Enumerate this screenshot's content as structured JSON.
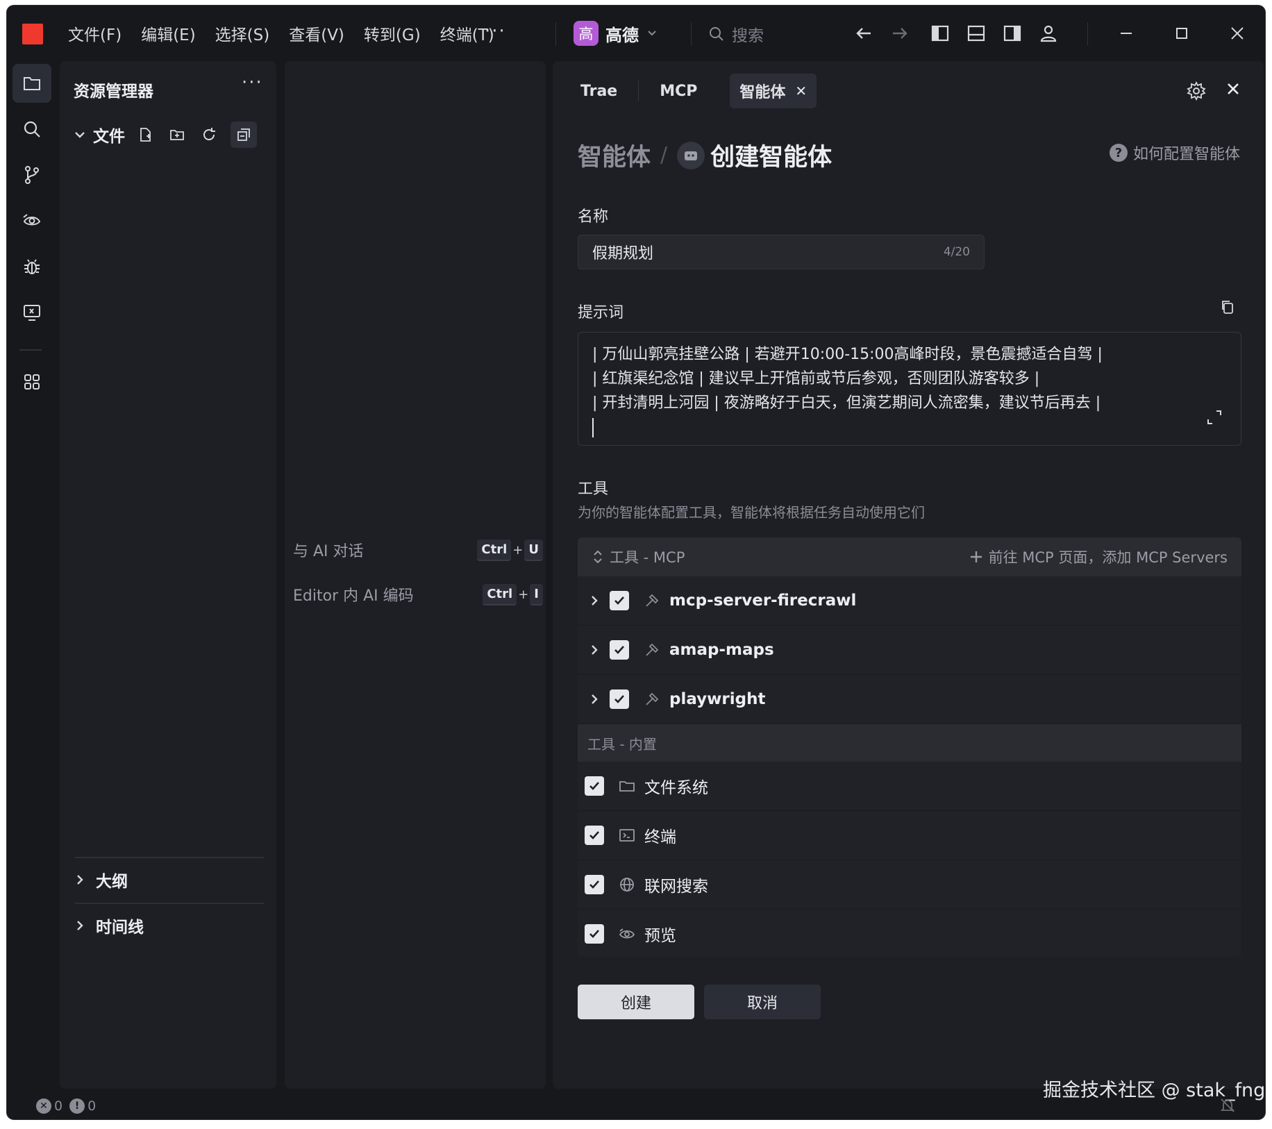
{
  "menu": [
    "文件(F)",
    "编辑(E)",
    "选择(S)",
    "查看(V)",
    "转到(G)",
    "终端(T)"
  ],
  "menu_more": "···",
  "project": {
    "avatar": "高",
    "name": "高德"
  },
  "search": {
    "placeholder": "搜索"
  },
  "explorer": {
    "title": "资源管理器",
    "more": "···",
    "folder": "文件",
    "outline": "大纲",
    "timeline": "时间线"
  },
  "middle": {
    "shortcuts": [
      {
        "label": "与 AI 对话",
        "keys": [
          "Ctrl",
          "U"
        ]
      },
      {
        "label": "Editor 内 AI 编码",
        "keys": [
          "Ctrl",
          "I"
        ]
      }
    ],
    "plus": "+"
  },
  "agent": {
    "tabs": {
      "trae": "Trae",
      "mcp": "MCP",
      "agent": "智能体"
    },
    "tab_close": "✕",
    "breadcrumb": {
      "parent": "智能体",
      "slash": "/",
      "current": "创建智能体"
    },
    "help": {
      "icon": "?",
      "text": "如何配置智能体"
    },
    "name": {
      "label": "名称",
      "value": "假期规划",
      "count": "4/20"
    },
    "prompt": {
      "label": "提示词",
      "lines": [
        "| 万仙山郭亮挂壁公路 | 若避开10:00-15:00高峰时段，景色震撼适合自驾 |",
        "| 红旗渠纪念馆 | 建议早上开馆前或节后参观，否则团队游客较多 |",
        "| 开封清明上河园 | 夜游略好于白天，但演艺期间人流密集，建议节后再去 |"
      ]
    },
    "tools": {
      "label": "工具",
      "desc": "为你的智能体配置工具，智能体将根据任务自动使用它们",
      "mcp_header": "工具 - MCP",
      "mcp_add": "前往 MCP 页面，添加 MCP Servers",
      "mcp_items": [
        "mcp-server-firecrawl",
        "amap-maps",
        "playwright"
      ],
      "builtin_header": "工具 - 内置",
      "builtin_items": [
        "文件系统",
        "终端",
        "联网搜索",
        "预览"
      ]
    },
    "buttons": {
      "create": "创建",
      "cancel": "取消"
    }
  },
  "status": {
    "errors": "0",
    "warnings": "0",
    "error_icon": "✕",
    "warning_icon": "!"
  },
  "watermark": "掘金技术社区 @ stak_fng",
  "colors": {
    "logo": "#f0392e",
    "avatar": "#b35bd6",
    "background": "#17181c",
    "panel": "#1d1f24"
  }
}
